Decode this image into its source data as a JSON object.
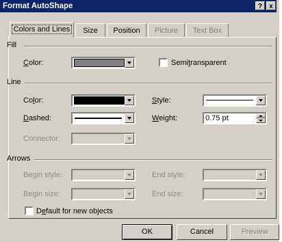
{
  "dialog": {
    "title": "Format AutoShape",
    "help_button": "?",
    "close_button": "x"
  },
  "tabs": [
    {
      "label": "Colors and Lines",
      "state": "active"
    },
    {
      "label": "Size",
      "state": "normal"
    },
    {
      "label": "Position",
      "state": "normal"
    },
    {
      "label": "Picture",
      "state": "disabled"
    },
    {
      "label": "Text Box",
      "state": "disabled"
    }
  ],
  "fill": {
    "section": "Fill",
    "color_label_u": "C",
    "color_label_rest": "olor:",
    "color_value": "#808080",
    "semitransparent_u": "Semi",
    "semitransparent_mid": "t",
    "semitransparent_rest": "ransparent",
    "semitransparent_checked": false
  },
  "line": {
    "section": "Line",
    "color_label_a": "Co",
    "color_label_u": "l",
    "color_label_b": "or:",
    "color_value": "#000000",
    "style_label_u": "S",
    "style_label_rest": "tyle:",
    "dashed_label_u": "D",
    "dashed_label_rest": "ashed:",
    "weight_label_u": "W",
    "weight_label_rest": "eight:",
    "weight_value": "0.75 pt",
    "connector_label": "Connector:"
  },
  "arrows": {
    "section": "Arrows",
    "begin_style": "Begin style:",
    "end_style": "End style:",
    "begin_size": "Begin size:",
    "end_size": "End size:"
  },
  "default_checkbox": {
    "label_a": "D",
    "label_u": "e",
    "label_b": "fault for new objects",
    "checked": false
  },
  "buttons": {
    "ok": "OK",
    "cancel": "Cancel",
    "preview": "Preview"
  }
}
